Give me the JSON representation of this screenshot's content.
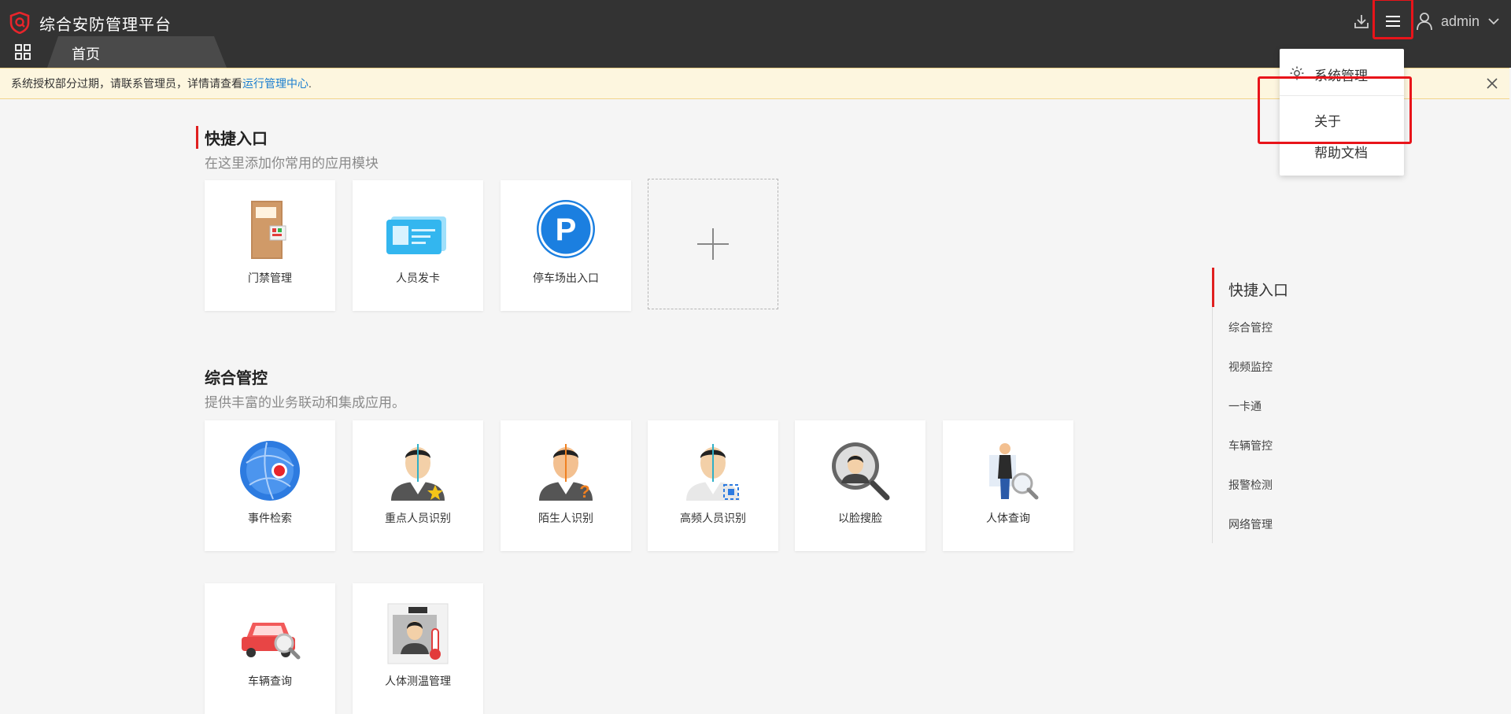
{
  "app": {
    "title": "综合安防管理平台"
  },
  "header": {
    "username": "admin"
  },
  "tabs": [
    {
      "label": "首页"
    }
  ],
  "notice": {
    "text": "系统授权部分过期，请联系管理员，详情请查看",
    "link": "运行管理中心",
    "suffix": "."
  },
  "quick": {
    "title": "快捷入口",
    "subtitle": "在这里添加你常用的应用模块",
    "cards": [
      {
        "label": "门禁管理",
        "icon": "door-icon"
      },
      {
        "label": "人员发卡",
        "icon": "card-issue-icon"
      },
      {
        "label": "停车场出入口",
        "icon": "parking-icon"
      }
    ]
  },
  "integrated": {
    "title": "综合管控",
    "subtitle": "提供丰富的业务联动和集成应用。",
    "cards": [
      {
        "label": "事件检索",
        "icon": "event-search-icon"
      },
      {
        "label": "重点人员识别",
        "icon": "key-person-icon"
      },
      {
        "label": "陌生人识别",
        "icon": "stranger-icon"
      },
      {
        "label": "高频人员识别",
        "icon": "frequent-person-icon"
      },
      {
        "label": "以脸搜脸",
        "icon": "face-search-icon"
      },
      {
        "label": "人体查询",
        "icon": "body-search-icon"
      },
      {
        "label": "车辆查询",
        "icon": "vehicle-search-icon"
      },
      {
        "label": "人体测温管理",
        "icon": "temperature-icon"
      }
    ]
  },
  "sidenav": {
    "items": [
      "快捷入口",
      "综合管控",
      "视频监控",
      "一卡通",
      "车辆管控",
      "报警检测",
      "网络管理"
    ]
  },
  "dropdown": {
    "items": [
      "系统管理",
      "关于",
      "帮助文档"
    ]
  },
  "colors": {
    "accent": "#e02020",
    "topbar": "#333333",
    "link": "#1a7ed0"
  }
}
